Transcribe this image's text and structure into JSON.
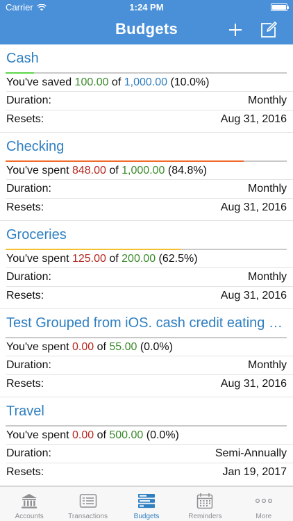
{
  "status": {
    "carrier": "Carrier",
    "time": "1:24 PM"
  },
  "nav": {
    "title": "Budgets",
    "add_icon": "plus-icon",
    "edit_icon": "compose-icon"
  },
  "budgets": [
    {
      "name": "Cash",
      "verb": "You've saved ",
      "spent": "100.00",
      "of": " of ",
      "total": "1,000.00",
      "pct": " (10.0%)",
      "progress": 0.1,
      "bar_color": "#5cd64a",
      "spent_class": "amt-green",
      "total_class": "amt-blue",
      "duration_label": "Duration:",
      "duration": "Monthly",
      "resets_label": "Resets:",
      "resets": "Aug 31, 2016"
    },
    {
      "name": "Checking",
      "verb": "You've spent ",
      "spent": "848.00",
      "of": " of ",
      "total": "1,000.00",
      "pct": " (84.8%)",
      "progress": 0.848,
      "bar_color": "#f06a2a",
      "spent_class": "amt-red",
      "total_class": "amt-green",
      "duration_label": "Duration:",
      "duration": "Monthly",
      "resets_label": "Resets:",
      "resets": "Aug 31, 2016"
    },
    {
      "name": "Groceries",
      "verb": "You've spent ",
      "spent": "125.00",
      "of": " of ",
      "total": "200.00",
      "pct": " (62.5%)",
      "progress": 0.625,
      "bar_color": "#f5c030",
      "spent_class": "amt-red",
      "total_class": "amt-green",
      "duration_label": "Duration:",
      "duration": "Monthly",
      "resets_label": "Resets:",
      "resets": "Aug 31, 2016"
    },
    {
      "name": "Test Grouped from iOS. cash credit eating out",
      "verb": "You've spent ",
      "spent": "0.00",
      "of": " of ",
      "total": "55.00",
      "pct": " (0.0%)",
      "progress": 0.0,
      "bar_color": "#5cd64a",
      "spent_class": "amt-red",
      "total_class": "amt-green",
      "duration_label": "Duration:",
      "duration": "Monthly",
      "resets_label": "Resets:",
      "resets": "Aug 31, 2016"
    },
    {
      "name": "Travel",
      "verb": "You've spent ",
      "spent": "0.00",
      "of": " of ",
      "total": "500.00",
      "pct": " (0.0%)",
      "progress": 0.0,
      "bar_color": "#5cd64a",
      "spent_class": "amt-red",
      "total_class": "amt-green",
      "duration_label": "Duration:",
      "duration": "Semi-Annually",
      "resets_label": "Resets:",
      "resets": "Jan 19, 2017"
    }
  ],
  "tabs": [
    {
      "label": "Accounts",
      "icon": "bank-icon",
      "active": false
    },
    {
      "label": "Transactions",
      "icon": "list-icon",
      "active": false
    },
    {
      "label": "Budgets",
      "icon": "budgets-icon",
      "active": true
    },
    {
      "label": "Reminders",
      "icon": "calendar-icon",
      "active": false
    },
    {
      "label": "More",
      "icon": "more-icon",
      "active": false
    }
  ],
  "colors": {
    "nav_bg": "#4a90d9",
    "accent": "#2f7fc1",
    "tab_inactive": "#8e8e93"
  }
}
